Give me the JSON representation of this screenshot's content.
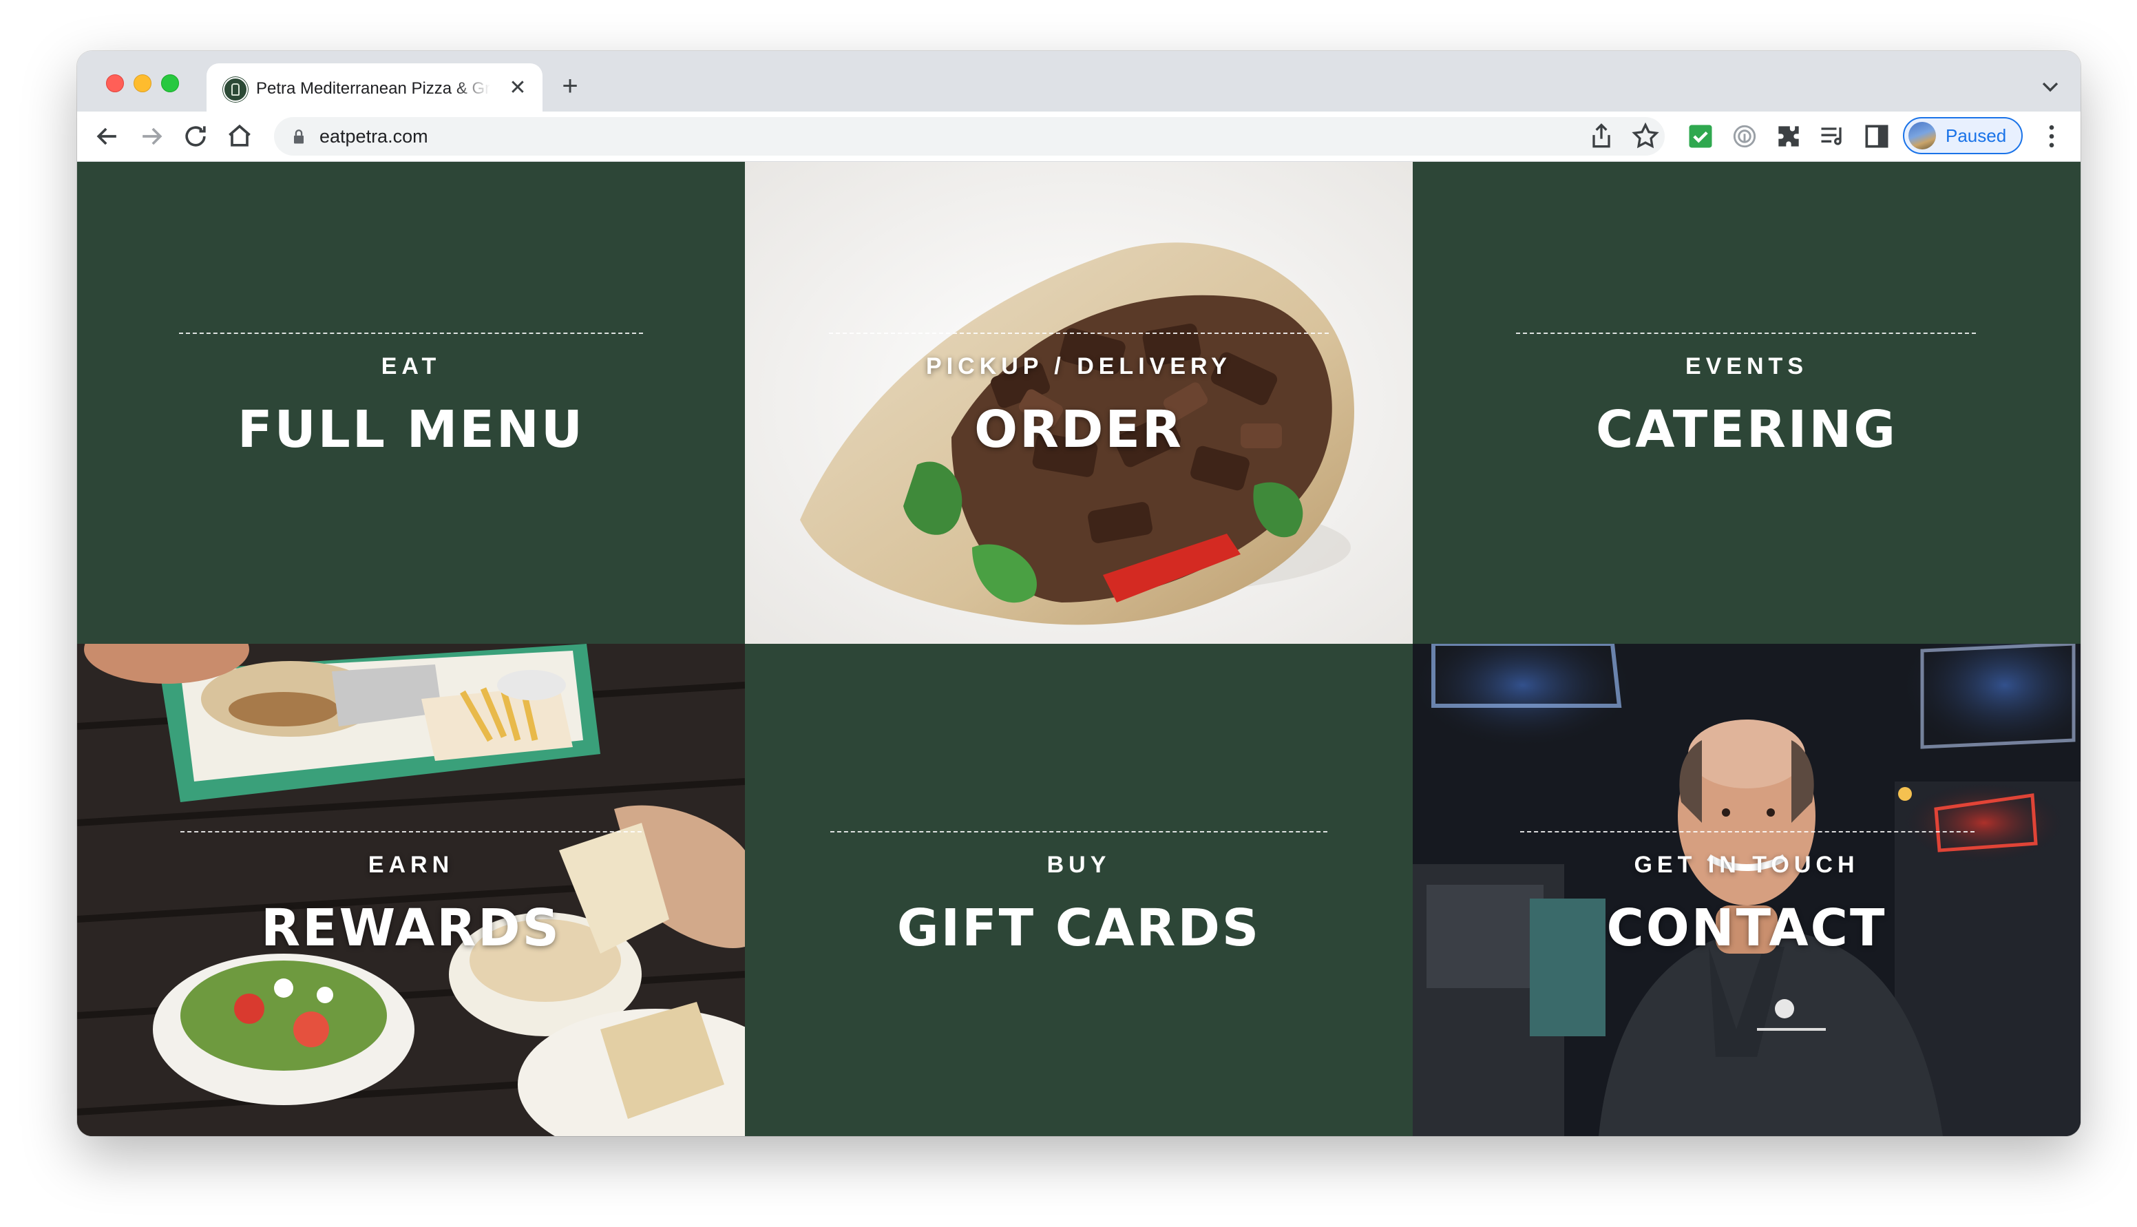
{
  "browser": {
    "tab_title": "Petra Mediterranean Pizza & Grill",
    "new_tab_symbol": "+",
    "close_symbol": "✕",
    "url": "eatpetra.com",
    "profile_label": "Paused",
    "icons": [
      "back-icon",
      "forward-icon",
      "reload-icon",
      "home-icon",
      "lock-icon",
      "share-icon",
      "bookmark-star-icon",
      "checkbox-extension-icon",
      "fingerprint-extension-icon",
      "puzzle-extensions-icon",
      "reading-list-icon",
      "side-panel-icon",
      "menu-kebab-icon",
      "tab-search-icon"
    ]
  },
  "tiles": [
    {
      "eyebrow": "EAT",
      "title": "FULL MENU"
    },
    {
      "eyebrow": "PICKUP / DELIVERY",
      "title": "ORDER"
    },
    {
      "eyebrow": "EVENTS",
      "title": "CATERING"
    },
    {
      "eyebrow": "EARN",
      "title": "REWARDS"
    },
    {
      "eyebrow": "BUY",
      "title": "GIFT CARDS"
    },
    {
      "eyebrow": "GET IN TOUCH",
      "title": "CONTACT"
    }
  ],
  "colors": {
    "brand_green": "#2d4637",
    "profile_blue": "#1a73e8"
  }
}
